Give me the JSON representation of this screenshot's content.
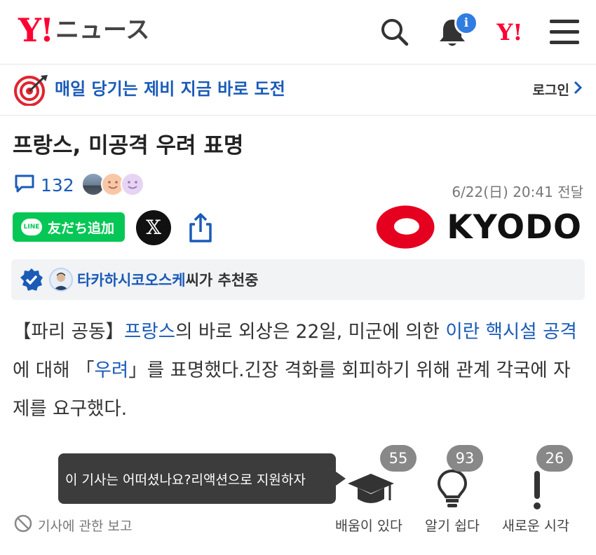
{
  "header": {
    "logo_mark": "Y!",
    "logo_text": "ニュース",
    "small_logo": "Y!",
    "notification_badge": "i",
    "brand_color": "#ff0033"
  },
  "banner": {
    "text": "매일 당기는 제비 지금 바로 도전",
    "login_label": "로그인",
    "text_color": "#1a5bb8"
  },
  "article": {
    "title": "프랑스, 미공격 우려 표명",
    "comment_count": "132",
    "date": "6/22(日) 20:41 전달",
    "share": {
      "line_icon_text": "LINE",
      "line_label": "友だち追加",
      "x_label": "𝕏"
    },
    "source_logo": "KYODO",
    "recommend": {
      "name": "타카하시코오스케",
      "suffix": "씨가 추천중"
    },
    "body": {
      "p1": "【파리 공동】",
      "l1": "프랑스",
      "p2": "의 바로 외상은 22일, 미군에 의한 ",
      "l2": "이란 핵시설 공격",
      "p3": "에 대해 「",
      "l3": "우려",
      "p4": "」를 표명했다.긴장 격화를 회피하기 위해 관계 각국에 자제를 요구했다."
    }
  },
  "reactions": {
    "tooltip": "이 기사는 어떠셨나요?리액션으로 지원하자",
    "items": [
      {
        "icon": "graduation-cap-icon",
        "count": "55",
        "label": "배움이 있다"
      },
      {
        "icon": "lightbulb-icon",
        "count": "93",
        "label": "알기 쉽다"
      },
      {
        "icon": "exclamation-icon",
        "count": "26",
        "label": "새로운 시각"
      }
    ],
    "report_label": "기사에 관한 보고"
  }
}
